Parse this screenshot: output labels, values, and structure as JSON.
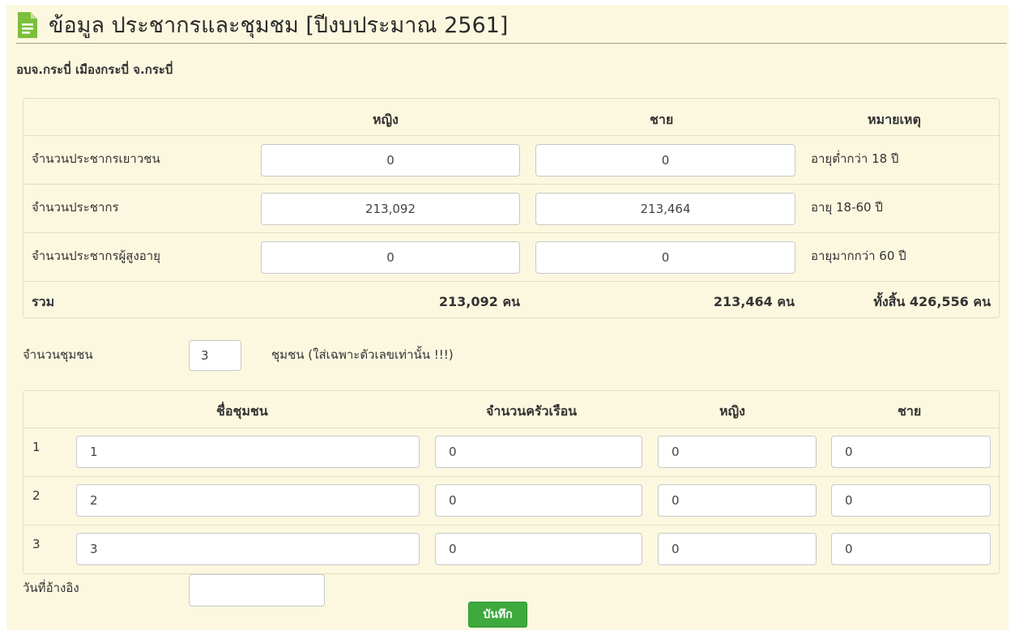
{
  "header": {
    "title": "ข้อมูล ประชากรและชุมชม [ปีงบประมาณ 2561]",
    "subtitle": "อบจ.กระบี่ เมืองกระบี่ จ.กระบี่",
    "icon": "document-icon",
    "icon_color": "#7bbf3a"
  },
  "population": {
    "headers": {
      "female": "หญิง",
      "male": "ชาย",
      "note": "หมายเหตุ"
    },
    "rows": [
      {
        "label": "จำนวนประชากรเยาวชน",
        "female": "0",
        "male": "0",
        "note": "อายุต่ำกว่า 18 ปี"
      },
      {
        "label": "จำนวนประชากร",
        "female": "213,092",
        "male": "213,464",
        "note": "อายุ 18-60 ปี"
      },
      {
        "label": "จำนวนประชากรผู้สูงอายุ",
        "female": "0",
        "male": "0",
        "note": "อายุมากกว่า 60 ปี"
      }
    ],
    "total": {
      "label": "รวม",
      "female": "213,092 คน",
      "male": "213,464 คน",
      "all": "ทั้งสิ้น 426,556 คน"
    }
  },
  "community_count": {
    "label": "จำนวนชุมชน",
    "value": "3",
    "hint": "ชุมชน (ใส่เฉพาะตัวเลขเท่านั้น !!!)"
  },
  "communities": {
    "headers": {
      "name": "ชื่อชุมชน",
      "households": "จำนวนครัวเรือน",
      "female": "หญิง",
      "male": "ชาย"
    },
    "rows": [
      {
        "no": "1",
        "name": "1",
        "households": "0",
        "female": "0",
        "male": "0"
      },
      {
        "no": "2",
        "name": "2",
        "households": "0",
        "female": "0",
        "male": "0"
      },
      {
        "no": "3",
        "name": "3",
        "households": "0",
        "female": "0",
        "male": "0"
      }
    ]
  },
  "reference_date": {
    "label": "วันที่อ้างอิง",
    "value": ""
  },
  "save_label": "บันทึก",
  "colors": {
    "panel_bg": "#fcf8e0",
    "border": "#e3dfc5",
    "save_button": "#3eaa3e"
  }
}
